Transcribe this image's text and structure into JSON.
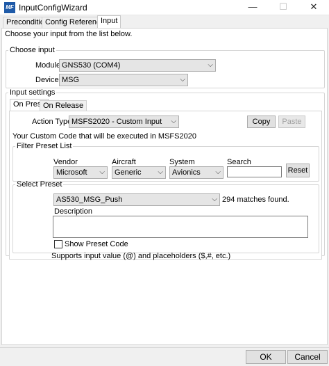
{
  "window": {
    "title": "InputConfigWizard",
    "icon_label": "MF",
    "minimize": "—",
    "maximize": "☐",
    "close": "✕"
  },
  "tabs": [
    {
      "label": "Precondition"
    },
    {
      "label": "Config References"
    },
    {
      "label": "Input"
    }
  ],
  "instruction": "Choose your input from the list below.",
  "choose_input": {
    "legend": "Choose input",
    "module_label": "Module",
    "module_value": "GNS530 (COM4)",
    "device_label": "Device",
    "device_value": "MSG"
  },
  "input_settings": {
    "legend": "Input settings",
    "subtabs": [
      {
        "label": "On Press"
      },
      {
        "label": "On Release"
      }
    ],
    "action_type_label": "Action Type",
    "action_type_value": "MSFS2020 - Custom Input",
    "copy_label": "Copy",
    "paste_label": "Paste",
    "custom_code_text": "Your Custom Code that will be executed in MSFS2020"
  },
  "filter": {
    "legend": "Filter Preset List",
    "vendor_label": "Vendor",
    "vendor_value": "Microsoft",
    "aircraft_label": "Aircraft",
    "aircraft_value": "Generic",
    "system_label": "System",
    "system_value": "Avionics",
    "search_label": "Search",
    "search_value": "",
    "reset_label": "Reset"
  },
  "preset": {
    "legend": "Select Preset",
    "value": "AS530_MSG_Push",
    "matches": "294 matches found.",
    "description_label": "Description",
    "description_value": "",
    "show_code_label": "Show Preset Code",
    "supports_text": "Supports input value (@) and placeholders ($,#, etc.)"
  },
  "footer": {
    "ok_label": "OK",
    "cancel_label": "Cancel"
  }
}
